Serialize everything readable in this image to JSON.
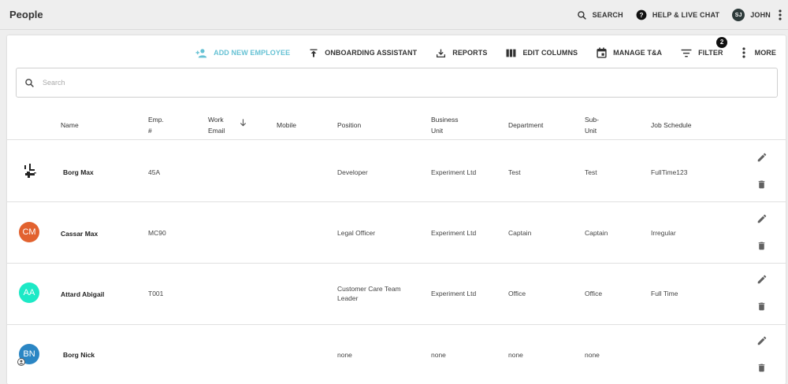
{
  "page": {
    "title": "People"
  },
  "top_actions": {
    "search_label": "SEARCH",
    "help_label": "HELP & LIVE CHAT",
    "user_initials": "SJ",
    "user_name": "JOHN"
  },
  "toolbar": {
    "add_employee": "ADD NEW EMPLOYEE",
    "onboarding": "ONBOARDING ASSISTANT",
    "reports": "REPORTS",
    "edit_columns": "EDIT COLUMNS",
    "manage_ta": "MANAGE T&A",
    "filter": "FILTER",
    "filter_count": "2",
    "more": "MORE"
  },
  "search": {
    "placeholder": "Search"
  },
  "columns": {
    "name": "Name",
    "emp_no_1": "Emp.",
    "emp_no_2": "#",
    "email_1": "Work",
    "email_2": "Email",
    "mobile": "Mobile",
    "position": "Position",
    "bu_1": "Business",
    "bu_2": "Unit",
    "department": "Department",
    "sub_1": "Sub-",
    "sub_2": "Unit",
    "schedule": "Job Schedule"
  },
  "rows": [
    {
      "initials": "",
      "avatar_color": "#ffffff",
      "name": "Borg Max",
      "emp": "45A",
      "email": "",
      "mobile": "",
      "position_1": "Developer",
      "position_2": "",
      "bu": "Experiment Ltd",
      "department": "Test",
      "subunit": "Test",
      "schedule": "FullTime123"
    },
    {
      "initials": "CM",
      "avatar_color": "#e2622f",
      "name": "Cassar Max",
      "emp": "MC90",
      "email": "",
      "mobile": "",
      "position_1": "Legal Officer",
      "position_2": "",
      "bu": "Experiment Ltd",
      "department": "Captain",
      "subunit": "Captain",
      "schedule": "Irregular"
    },
    {
      "initials": "AA",
      "avatar_color": "#1de9c6",
      "name": "Attard Abigail",
      "emp": "T001",
      "email": "",
      "mobile": "",
      "position_1": "Customer Care Team",
      "position_2": "Leader",
      "bu": "Experiment Ltd",
      "department": "Office",
      "subunit": "Office",
      "schedule": "Full Time"
    },
    {
      "initials": "BN",
      "avatar_color": "#2b86c4",
      "name": "Borg Nick",
      "emp": "",
      "email": "",
      "mobile": "",
      "position_1": "none",
      "position_2": "",
      "bu": "none",
      "department": "none",
      "subunit": "none",
      "schedule": ""
    }
  ],
  "colors": {
    "accent": "#67c2d4",
    "text": "#333333",
    "icon": "#616161"
  },
  "icons": [
    "search-icon",
    "help-icon",
    "kebab-icon",
    "add-person-icon",
    "upload-icon",
    "download-icon",
    "columns-icon",
    "calendar-icon",
    "filter-icon",
    "sort-down-icon",
    "edit-icon",
    "delete-icon"
  ]
}
